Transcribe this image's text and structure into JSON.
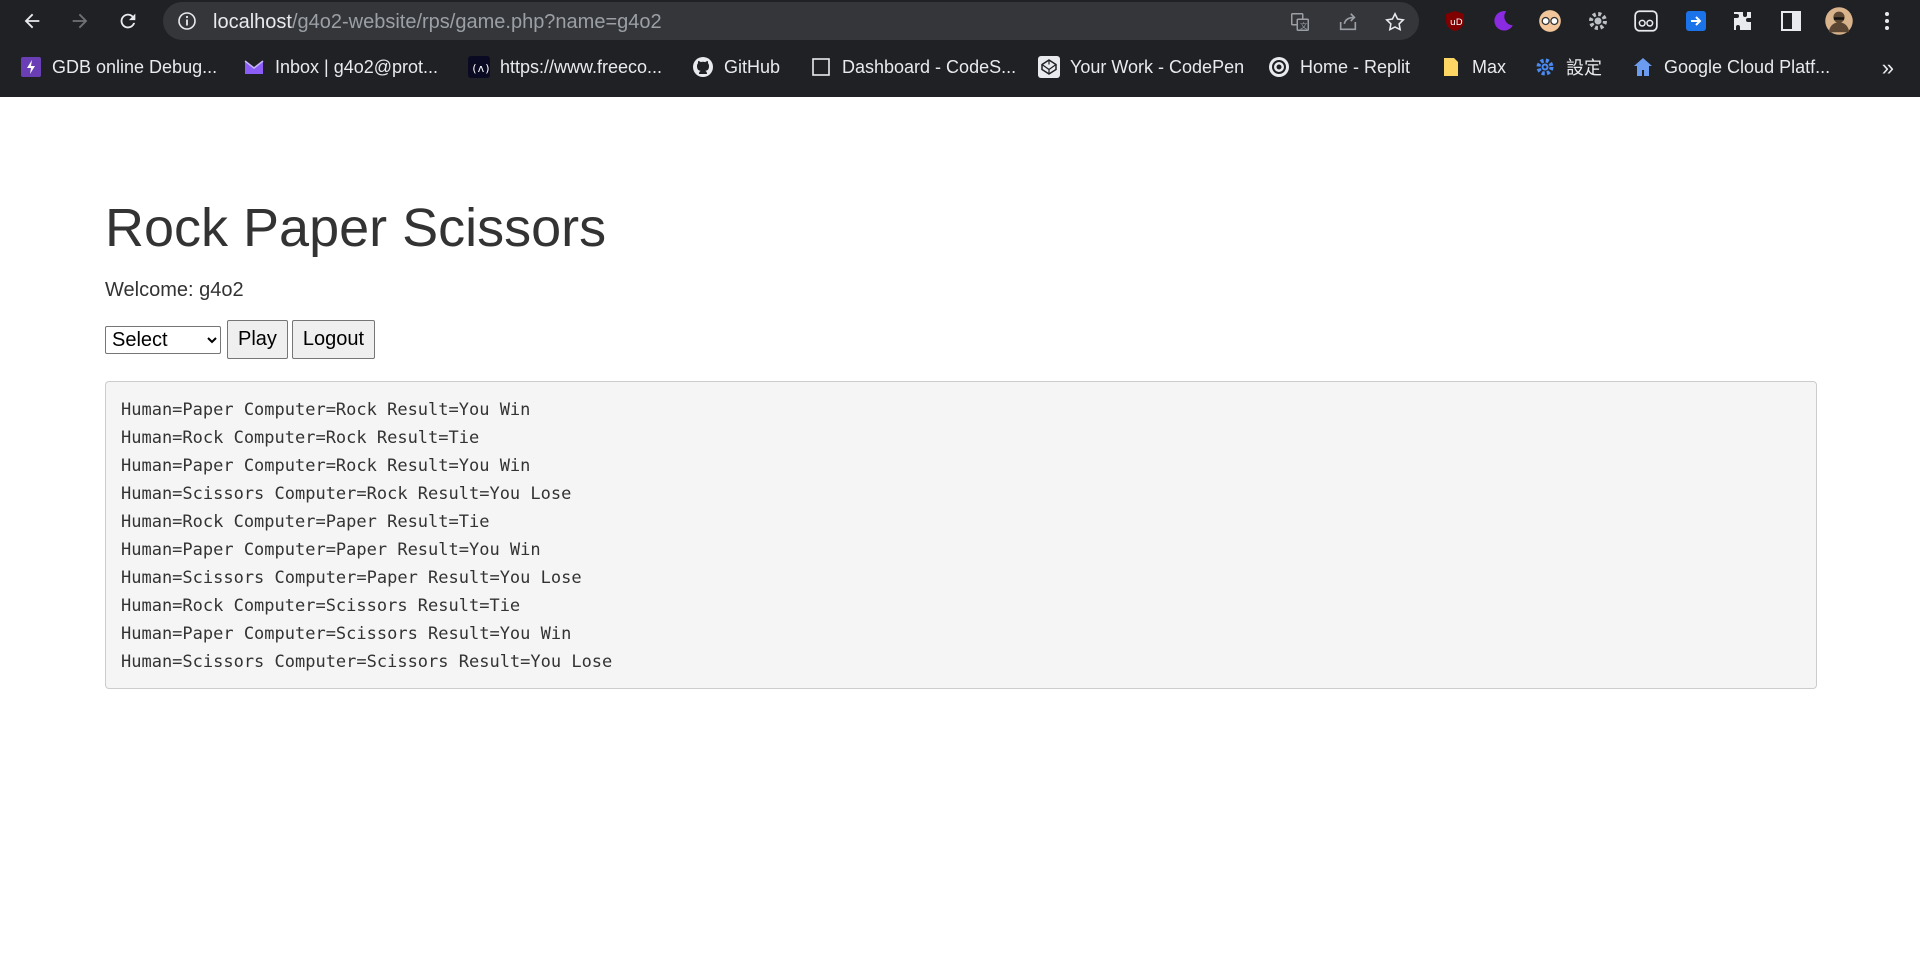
{
  "browser": {
    "url_host": "localhost",
    "url_path": "/g4o2-website/rps/game.php?name=g4o2",
    "bookmarks": [
      {
        "label": "GDB online Debug...",
        "icon": "gdb-icon"
      },
      {
        "label": "Inbox | g4o2@prot...",
        "icon": "proton-mail-icon"
      },
      {
        "label": "https://www.freeco...",
        "icon": "freecodecamp-icon"
      },
      {
        "label": "GitHub",
        "icon": "github-icon"
      },
      {
        "label": "Dashboard - CodeS...",
        "icon": "codesignal-icon"
      },
      {
        "label": "Your Work - CodePen",
        "icon": "codepen-icon"
      },
      {
        "label": "Home - Replit",
        "icon": "replit-icon"
      },
      {
        "label": "Max",
        "icon": "folder-icon"
      },
      {
        "label": "設定",
        "icon": "gear-icon"
      },
      {
        "label": "Google Cloud Platf...",
        "icon": "home-icon"
      }
    ],
    "more": "»"
  },
  "page": {
    "title": "Rock Paper Scissors",
    "welcome": "Welcome: g4o2",
    "select": {
      "selected": "Select",
      "options": [
        "Select"
      ]
    },
    "play_label": "Play",
    "logout_label": "Logout",
    "results": [
      "Human=Paper Computer=Rock Result=You Win",
      "Human=Rock Computer=Rock Result=Tie",
      "Human=Paper Computer=Rock Result=You Win",
      "Human=Scissors Computer=Rock Result=You Lose",
      "Human=Rock Computer=Paper Result=Tie",
      "Human=Paper Computer=Paper Result=You Win",
      "Human=Scissors Computer=Paper Result=You Lose",
      "Human=Rock Computer=Scissors Result=Tie",
      "Human=Paper Computer=Scissors Result=You Win",
      "Human=Scissors Computer=Scissors Result=You Lose"
    ]
  },
  "colors": {
    "chrome_bg": "#202124",
    "omnibox_bg": "#35363a",
    "heading_text": "#333333",
    "pre_bg": "#f5f5f5"
  }
}
